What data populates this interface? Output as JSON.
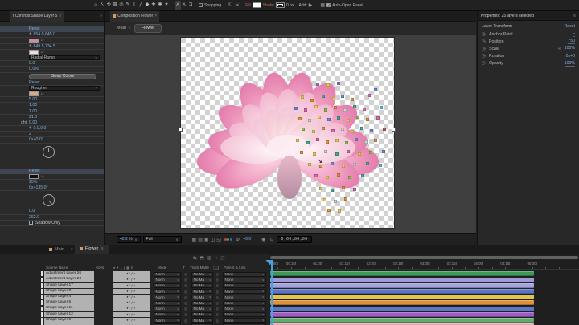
{
  "toolbar": {
    "tools": [
      {
        "name": "home-tool-icon",
        "glyph": "⌂"
      },
      {
        "name": "selection-tool-icon",
        "glyph": "↖"
      },
      {
        "name": "rotation-tool-icon",
        "glyph": "⟲"
      },
      {
        "name": "pan-behind-tool-icon",
        "glyph": "⊞"
      },
      {
        "name": "zoom-tool-icon",
        "glyph": "◎"
      },
      {
        "name": "pen-tool-icon",
        "glyph": "✎"
      },
      {
        "name": "type-tool-icon",
        "glyph": "T"
      },
      {
        "name": "line-tool-icon",
        "glyph": "╱"
      },
      {
        "name": "mask-shape-tool-icon",
        "glyph": "◆"
      },
      {
        "name": "brush-tool-icon",
        "glyph": "✚"
      },
      {
        "name": "clone-stamp-tool-icon",
        "glyph": "✱"
      },
      {
        "name": "puppet-pin-tool-icon",
        "glyph": "✦"
      }
    ],
    "extra_tools": [
      {
        "name": "local-axis-mode-icon",
        "glyph": "⋏",
        "active": true
      },
      {
        "name": "world-axis-mode-icon",
        "glyph": "⋏",
        "active": false
      },
      {
        "name": "view-axis-mode-icon",
        "glyph": "⊐",
        "active": false
      }
    ],
    "snapping_label": "Snapping",
    "fill_label": "Fill",
    "stroke_label": "Stroke",
    "stroke_width": "0 px",
    "add_label": "Add:",
    "auto_open_label": "Auto-Open Panel"
  },
  "effect_controls": {
    "tab_title": "t Controls:Shape Layer 5",
    "rows": [
      {
        "type": "reset",
        "text": "Reset",
        "hl": true
      },
      {
        "type": "point",
        "value": "854.0,645.0"
      },
      {
        "type": "color",
        "color": "#cf8ba1"
      },
      {
        "type": "point",
        "value": "849.5,734.5"
      },
      {
        "type": "color",
        "color": "#f0dbe2"
      },
      {
        "type": "dropdown",
        "value": "Radial Ramp"
      },
      {
        "type": "value",
        "value": "0.0"
      },
      {
        "type": "value",
        "value": "0.0%"
      },
      {
        "type": "button",
        "text": "Swap Colors"
      },
      {
        "type": "reset",
        "text": "Reset"
      },
      {
        "type": "dropdown",
        "value": "Roughen"
      },
      {
        "type": "color",
        "color": "#dca87e"
      },
      {
        "type": "value",
        "value": "5.00"
      },
      {
        "type": "value",
        "value": "1.00"
      },
      {
        "type": "value",
        "value": "1.00"
      },
      {
        "type": "value",
        "value": "21.0"
      },
      {
        "type": "value",
        "label": "ght",
        "value": "0.00"
      },
      {
        "type": "point",
        "value": "0.0,0.0"
      },
      {
        "type": "value",
        "value": "2"
      },
      {
        "type": "value",
        "value": "0x+0.0°"
      },
      {
        "type": "dial",
        "angle": 0
      },
      {
        "type": "gap"
      },
      {
        "type": "reset",
        "text": "Reset",
        "hl": true
      },
      {
        "type": "color",
        "color": "#111111"
      },
      {
        "type": "value",
        "value": "25%"
      },
      {
        "type": "value",
        "value": "0x+135.0°"
      },
      {
        "type": "dial",
        "angle": 135
      },
      {
        "type": "value",
        "value": "0.0"
      },
      {
        "type": "value",
        "value": "262.0"
      },
      {
        "type": "checkbox",
        "label": "Shadow Only"
      }
    ]
  },
  "composition": {
    "tab_title": "Composition Flower",
    "breadcrumb_root": "Main",
    "breadcrumb_current": "Flower"
  },
  "composition_bar": {
    "magnification": "42.2 %",
    "resolution": "Full",
    "exposure": "+0.0",
    "timecode": "0;00;00;00",
    "view_icons": [
      {
        "name": "transparency-grid-icon",
        "glyph": "▦"
      },
      {
        "name": "toggle-masks-icon",
        "glyph": "▤"
      },
      {
        "name": "region-of-interest-icon",
        "glyph": "▣"
      },
      {
        "name": "grid-guides-icon",
        "glyph": "◫"
      },
      {
        "name": "current-view-icon",
        "glyph": "◱"
      }
    ]
  },
  "canvas": {
    "handle_colors": [
      "#9b6fd0",
      "#e6c94e",
      "#e0913a",
      "#3fa98e",
      "#6a8bd8",
      "#d468b0",
      "#8fb84f",
      "#d0d0d0",
      "#c05555",
      "#5bbcd6"
    ],
    "handles": [
      [
        168,
        56,
        0
      ],
      [
        181,
        57,
        1
      ],
      [
        194,
        55,
        0
      ],
      [
        240,
        63,
        4
      ],
      [
        149,
        72,
        1
      ],
      [
        161,
        76,
        2
      ],
      [
        175,
        71,
        3
      ],
      [
        188,
        74,
        1
      ],
      [
        199,
        71,
        4
      ],
      [
        211,
        75,
        2
      ],
      [
        232,
        70,
        5
      ],
      [
        141,
        86,
        4
      ],
      [
        153,
        88,
        5
      ],
      [
        166,
        84,
        1
      ],
      [
        178,
        88,
        6
      ],
      [
        190,
        85,
        2
      ],
      [
        202,
        88,
        7
      ],
      [
        214,
        84,
        3
      ],
      [
        226,
        87,
        5
      ],
      [
        247,
        85,
        9
      ],
      [
        146,
        99,
        2
      ],
      [
        158,
        101,
        7
      ],
      [
        170,
        97,
        1
      ],
      [
        182,
        100,
        4
      ],
      [
        194,
        98,
        3
      ],
      [
        206,
        101,
        1
      ],
      [
        218,
        97,
        6
      ],
      [
        230,
        100,
        2
      ],
      [
        243,
        98,
        5
      ],
      [
        150,
        112,
        6
      ],
      [
        163,
        115,
        1
      ],
      [
        175,
        111,
        2
      ],
      [
        187,
        114,
        5
      ],
      [
        199,
        112,
        7
      ],
      [
        211,
        115,
        1
      ],
      [
        223,
        111,
        3
      ],
      [
        235,
        114,
        4
      ],
      [
        251,
        112,
        8
      ],
      [
        143,
        126,
        1
      ],
      [
        156,
        129,
        3
      ],
      [
        168,
        125,
        5
      ],
      [
        180,
        128,
        2
      ],
      [
        192,
        126,
        1
      ],
      [
        204,
        129,
        6
      ],
      [
        216,
        125,
        4
      ],
      [
        228,
        128,
        7
      ],
      [
        240,
        126,
        2
      ],
      [
        148,
        141,
        2
      ],
      [
        164,
        143,
        1
      ],
      [
        178,
        140,
        7
      ],
      [
        192,
        143,
        3
      ],
      [
        206,
        140,
        5
      ],
      [
        220,
        143,
        1
      ],
      [
        234,
        141,
        6
      ],
      [
        250,
        140,
        4
      ],
      [
        158,
        156,
        1
      ],
      [
        172,
        158,
        2
      ],
      [
        186,
        155,
        4
      ],
      [
        200,
        158,
        1
      ],
      [
        214,
        156,
        7
      ],
      [
        230,
        155,
        3
      ],
      [
        246,
        157,
        9
      ],
      [
        166,
        170,
        5
      ],
      [
        180,
        172,
        1
      ],
      [
        194,
        169,
        2
      ],
      [
        208,
        172,
        6
      ],
      [
        224,
        170,
        4
      ],
      [
        172,
        186,
        1
      ],
      [
        186,
        188,
        3
      ],
      [
        200,
        185,
        2
      ],
      [
        214,
        187,
        5
      ],
      [
        177,
        200,
        1
      ],
      [
        190,
        202,
        7
      ],
      [
        203,
        199,
        2
      ],
      [
        182,
        213,
        2
      ],
      [
        195,
        214,
        1
      ]
    ]
  },
  "properties": {
    "title": "Properties: 25 layers selected",
    "section": "Layer Transform",
    "reset_label": "Reset",
    "rows": [
      {
        "label": "Anchor Point",
        "value": "–",
        "chain": false
      },
      {
        "label": "Position",
        "value": "750",
        "chain": false
      },
      {
        "label": "Scale",
        "value": "100%",
        "chain": true
      },
      {
        "label": "Rotation",
        "value": "0x+0",
        "chain": false
      },
      {
        "label": "Opacity",
        "value": "100%",
        "chain": false
      }
    ]
  },
  "timeline": {
    "tabs": [
      {
        "label": "Main",
        "active": false
      },
      {
        "label": "Flower",
        "active": true
      }
    ],
    "columns": {
      "source_name": "Source Name",
      "keys": "Keys",
      "mode": "Mode",
      "t": "T",
      "track_matte": "Track Matte",
      "parent_link": "Parent & Link"
    },
    "switch_glyphs": "♦∕ƒ▪",
    "header_icon_glyphs": "♦✦∖ƒ▦⊘",
    "mode_value": "Norm",
    "matte_value": "No Ma",
    "parent_value": "None",
    "view_icons": [
      {
        "name": "mini-flowchart-icon",
        "glyph": "⇆"
      },
      {
        "name": "draft-3d-icon",
        "glyph": "⬒"
      },
      {
        "name": "frame-blending-icon",
        "glyph": "▥"
      },
      {
        "name": "motion-blur-icon",
        "glyph": "◑"
      },
      {
        "name": "graph-editor-icon",
        "glyph": "◳"
      }
    ],
    "ruler_labels": [
      "0:00f",
      "00:15f",
      "01:00f",
      "01:15f",
      "02:00f",
      "02:15f",
      "03:00f",
      "03:15f",
      "04:00f",
      "04:15f",
      "05:00f"
    ],
    "layers": [
      {
        "name": "Adjustment Layer 26",
        "color": "#3d9a55"
      },
      {
        "name": "Adjustment Layer 24",
        "color": "#9e9bd8"
      },
      {
        "name": "Shape Layer 17",
        "color": "#a5a2dc"
      },
      {
        "name": "Shape Layer 3",
        "color": "#5b76c9"
      },
      {
        "name": "Shape Layer 4",
        "color": "#e3c44d"
      },
      {
        "name": "Shape Layer 5",
        "color": "#df9038"
      },
      {
        "name": "Shape Layer 11",
        "color": "#5b76c9"
      },
      {
        "name": "Shape Layer 12",
        "color": "#a05ac0"
      },
      {
        "name": "Shape Layer 6",
        "color": "#63a96b"
      },
      {
        "name": "",
        "color": "#e7a4b8"
      }
    ]
  }
}
